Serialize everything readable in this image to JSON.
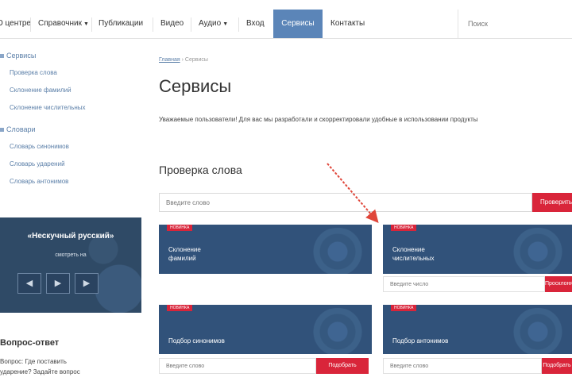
{
  "nav": {
    "items": [
      "О центре",
      "Справочник",
      "Публикации",
      "Видео",
      "Аудио",
      "Вход",
      "Сервисы",
      "Контакты"
    ],
    "active_index": 6,
    "dropdown_indices": [
      1,
      4
    ],
    "search_placeholder": "Поиск"
  },
  "sidebar": {
    "groups": [
      {
        "heading": "Сервисы",
        "links": [
          "Проверка слова",
          "Склонение фамилий",
          "Склонение числительных"
        ]
      },
      {
        "heading": "Словари",
        "links": [
          "Словарь синонимов",
          "Словарь ударений",
          "Словарь антонимов"
        ]
      }
    ],
    "promo": {
      "title": "«Нескучный русский»",
      "subtitle": "смотреть на",
      "buttons": [
        "◀",
        "▶",
        "▶"
      ]
    },
    "block_title": "Вопрос-ответ",
    "block_lines": [
      "Вопрос: Где поставить",
      "ударение? Задайте вопрос"
    ]
  },
  "main": {
    "breadcrumb": {
      "home": "Главная",
      "separator": "›",
      "current": "Сервисы"
    },
    "title": "Сервисы",
    "intro": "Уважаемые пользователи! Для вас мы разработали и скорректировали удобные в использовании продукты",
    "section_title": "Проверка слова",
    "check_placeholder": "Введите слово",
    "check_button": "Проверить",
    "cards": [
      {
        "badge": "НОВИНКА",
        "title": "Склонение фамилий",
        "input_placeholder": "",
        "button": ""
      },
      {
        "badge": "НОВИНКА",
        "title": "Склонение числительных",
        "input_placeholder": "Введите число",
        "button": "Просклонять"
      },
      {
        "badge": "НОВИНКА",
        "title": "Подбор синонимов",
        "input_placeholder": "Введите слово",
        "button": "Подобрать"
      },
      {
        "badge": "НОВИНКА",
        "title": "Подбор антонимов",
        "input_placeholder": "Введите слово",
        "button": "Подобрать"
      }
    ]
  },
  "colors": {
    "accent_blue": "#5b85b8",
    "card_blue": "#31527a",
    "action_red": "#d9253a",
    "annotation_red": "#e0463a"
  }
}
